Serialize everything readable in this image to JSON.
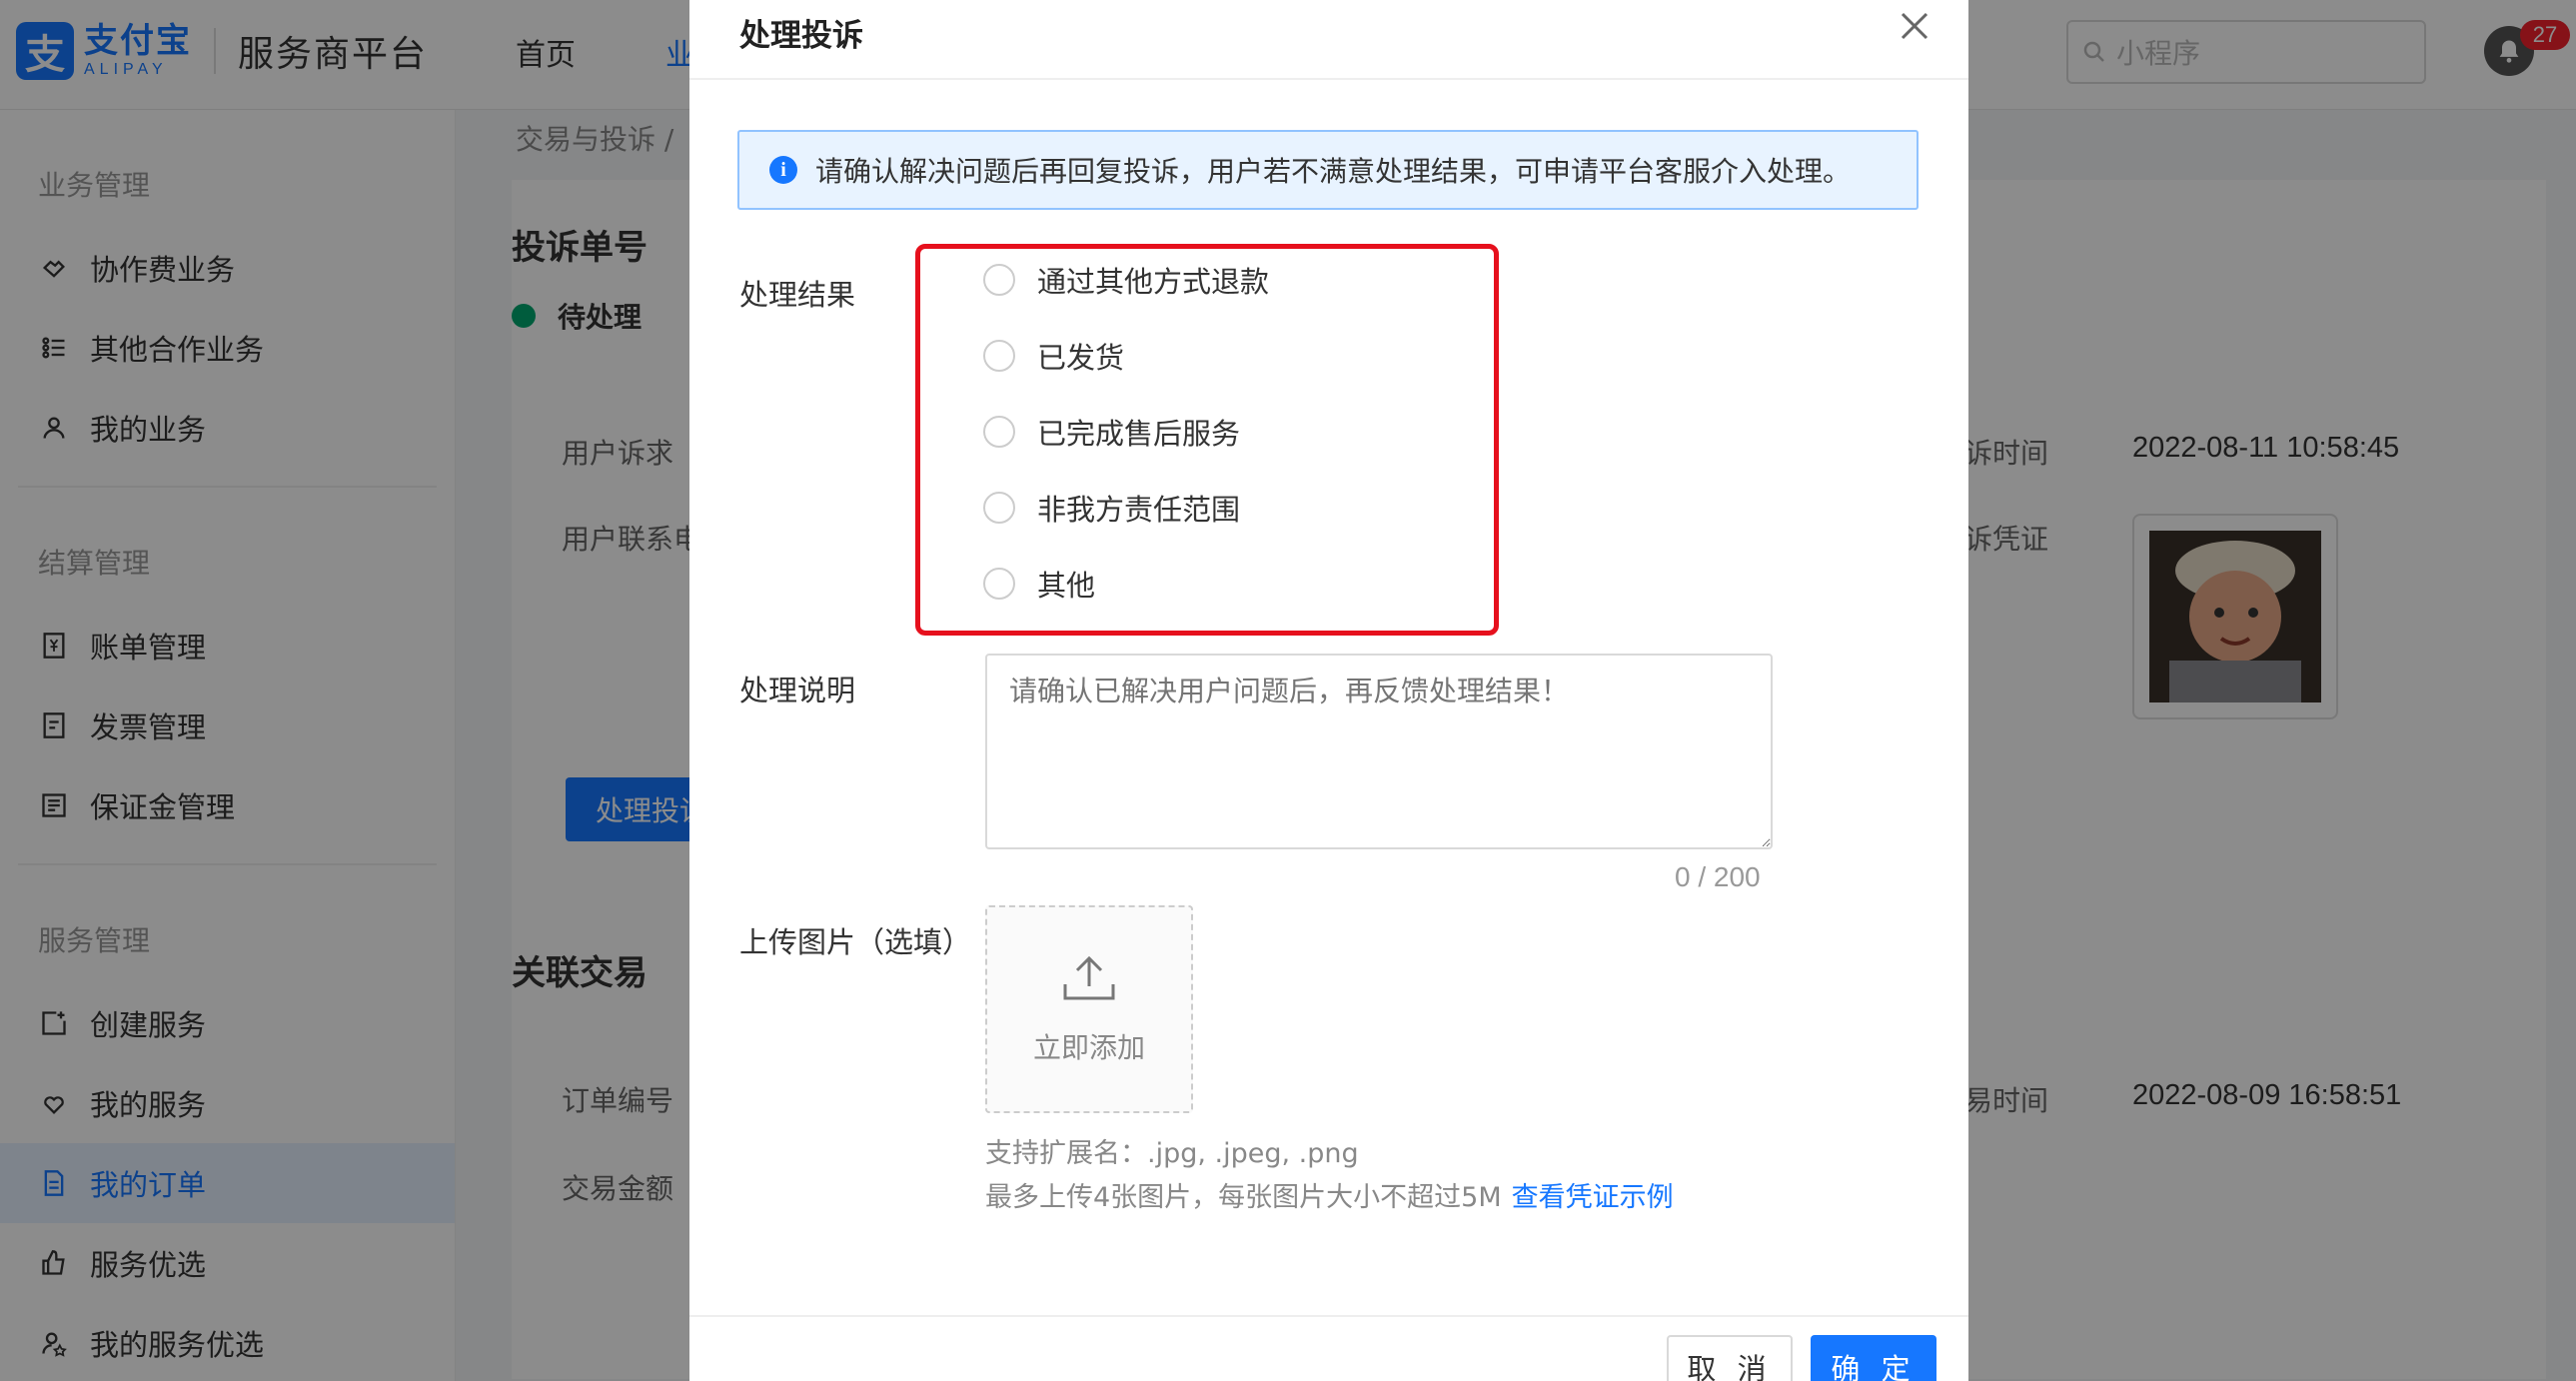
{
  "header": {
    "logo_cn": "支付宝",
    "logo_en": "ALIPAY",
    "platform_name": "服务商平台",
    "nav": [
      "首页",
      "业"
    ],
    "search_placeholder": "小程序",
    "notification_count": "27"
  },
  "sidebar": {
    "groups": [
      {
        "title": "业务管理",
        "items": [
          "协作费业务",
          "其他合作业务",
          "我的业务"
        ]
      },
      {
        "title": "结算管理",
        "items": [
          "账单管理",
          "发票管理",
          "保证金管理"
        ]
      },
      {
        "title": "服务管理",
        "items": [
          "创建服务",
          "我的服务",
          "我的订单",
          "服务优选",
          "我的服务优选"
        ]
      }
    ],
    "active_item": "我的订单"
  },
  "background": {
    "breadcrumb": "交易与投诉 /",
    "title": "投诉单号",
    "status": "待处理",
    "user_request_label": "用户诉求",
    "user_contact_label": "用户联系电",
    "process_button": "处理投诉",
    "related_title": "关联交易",
    "order_no_label": "订单编号",
    "amount_label": "交易金额",
    "complaint_time_label": "诉时间",
    "complaint_time": "2022-08-11 10:58:45",
    "evidence_label": "诉凭证",
    "trade_time_label": "易时间",
    "trade_time": "2022-08-09 16:58:51"
  },
  "modal": {
    "title": "处理投诉",
    "alert": "请确认解决问题后再回复投诉，用户若不满意处理结果，可申请平台客服介入处理。",
    "result_label": "处理结果",
    "options": [
      "通过其他方式退款",
      "已发货",
      "已完成售后服务",
      "非我方责任范围",
      "其他"
    ],
    "desc_label": "处理说明",
    "desc_placeholder": "请确认已解决用户问题后，再反馈处理结果！",
    "counter": "0 / 200",
    "upload_label": "上传图片（选填）",
    "upload_text": "立即添加",
    "hint_ext": "支持扩展名：.jpg, .jpeg, .png",
    "hint_limit": "最多上传4张图片，每张图片大小不超过5M",
    "hint_link": "查看凭证示例",
    "cancel": "取 消",
    "ok": "确 定"
  },
  "colors": {
    "primary": "#1677ff",
    "highlight": "#e6101d",
    "status": "#00a870"
  }
}
